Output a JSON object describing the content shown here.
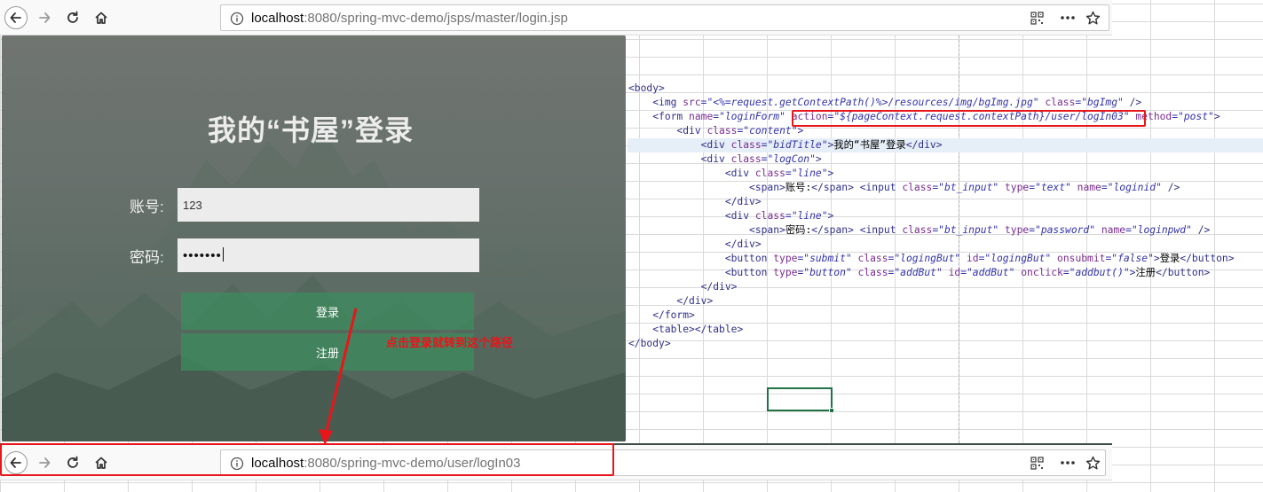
{
  "top_browser": {
    "url_host": "localhost",
    "url_rest": ":8080/spring-mvc-demo/jsps/master/login.jsp"
  },
  "login": {
    "title": "我的“书屋”登录",
    "account_label": "账号:",
    "account_value": "123",
    "password_label": "密码:",
    "password_value": "•••••••",
    "login_button": "登录",
    "register_button": "注册"
  },
  "annotation": {
    "text": "点击登录就转到这个路径",
    "color": "#e8151a"
  },
  "code_lines": [
    "<body>",
    "    <img src=\"<%=request.getContextPath()%>/resources/img/bgImg.jpg\" class=\"bgImg\" />",
    "    <form name=\"loginForm\" action=\"${pageContext.request.contextPath}/user/logIn03\" method=\"post\">",
    "        <div class=\"content\">",
    "            <div class=\"bidTitle\">我的“书屋”登录</div>",
    "            <div class=\"logCon\">",
    "                <div class=\"line\">",
    "                    <span>账号:</span> <input class=\"bt_input\" type=\"text\" name=\"loginid\" />",
    "                </div>",
    "                <div class=\"line\">",
    "                    <span>密码:</span> <input class=\"bt_input\" type=\"password\" name=\"loginpwd\" />",
    "                </div>",
    "                <button type=\"submit\" class=\"logingBut\" id=\"logingBut\" onsubmit=\"false\">登录</button>",
    "                <button type=\"button\" class=\"addBut\" id=\"addBut\" onclick=\"addbut()\">注册</button>",
    "            </div>",
    "        </div>",
    "    </form>",
    "    <table></table>",
    "</body>"
  ],
  "bottom_browser": {
    "url_host": "localhost",
    "url_rest": ":8080/spring-mvc-demo/user/logIn03"
  },
  "icons": [
    "back-icon",
    "forward-icon",
    "reload-icon",
    "home-icon",
    "info-icon",
    "qr-code-icon",
    "more-icon",
    "bookmark-star-icon"
  ]
}
